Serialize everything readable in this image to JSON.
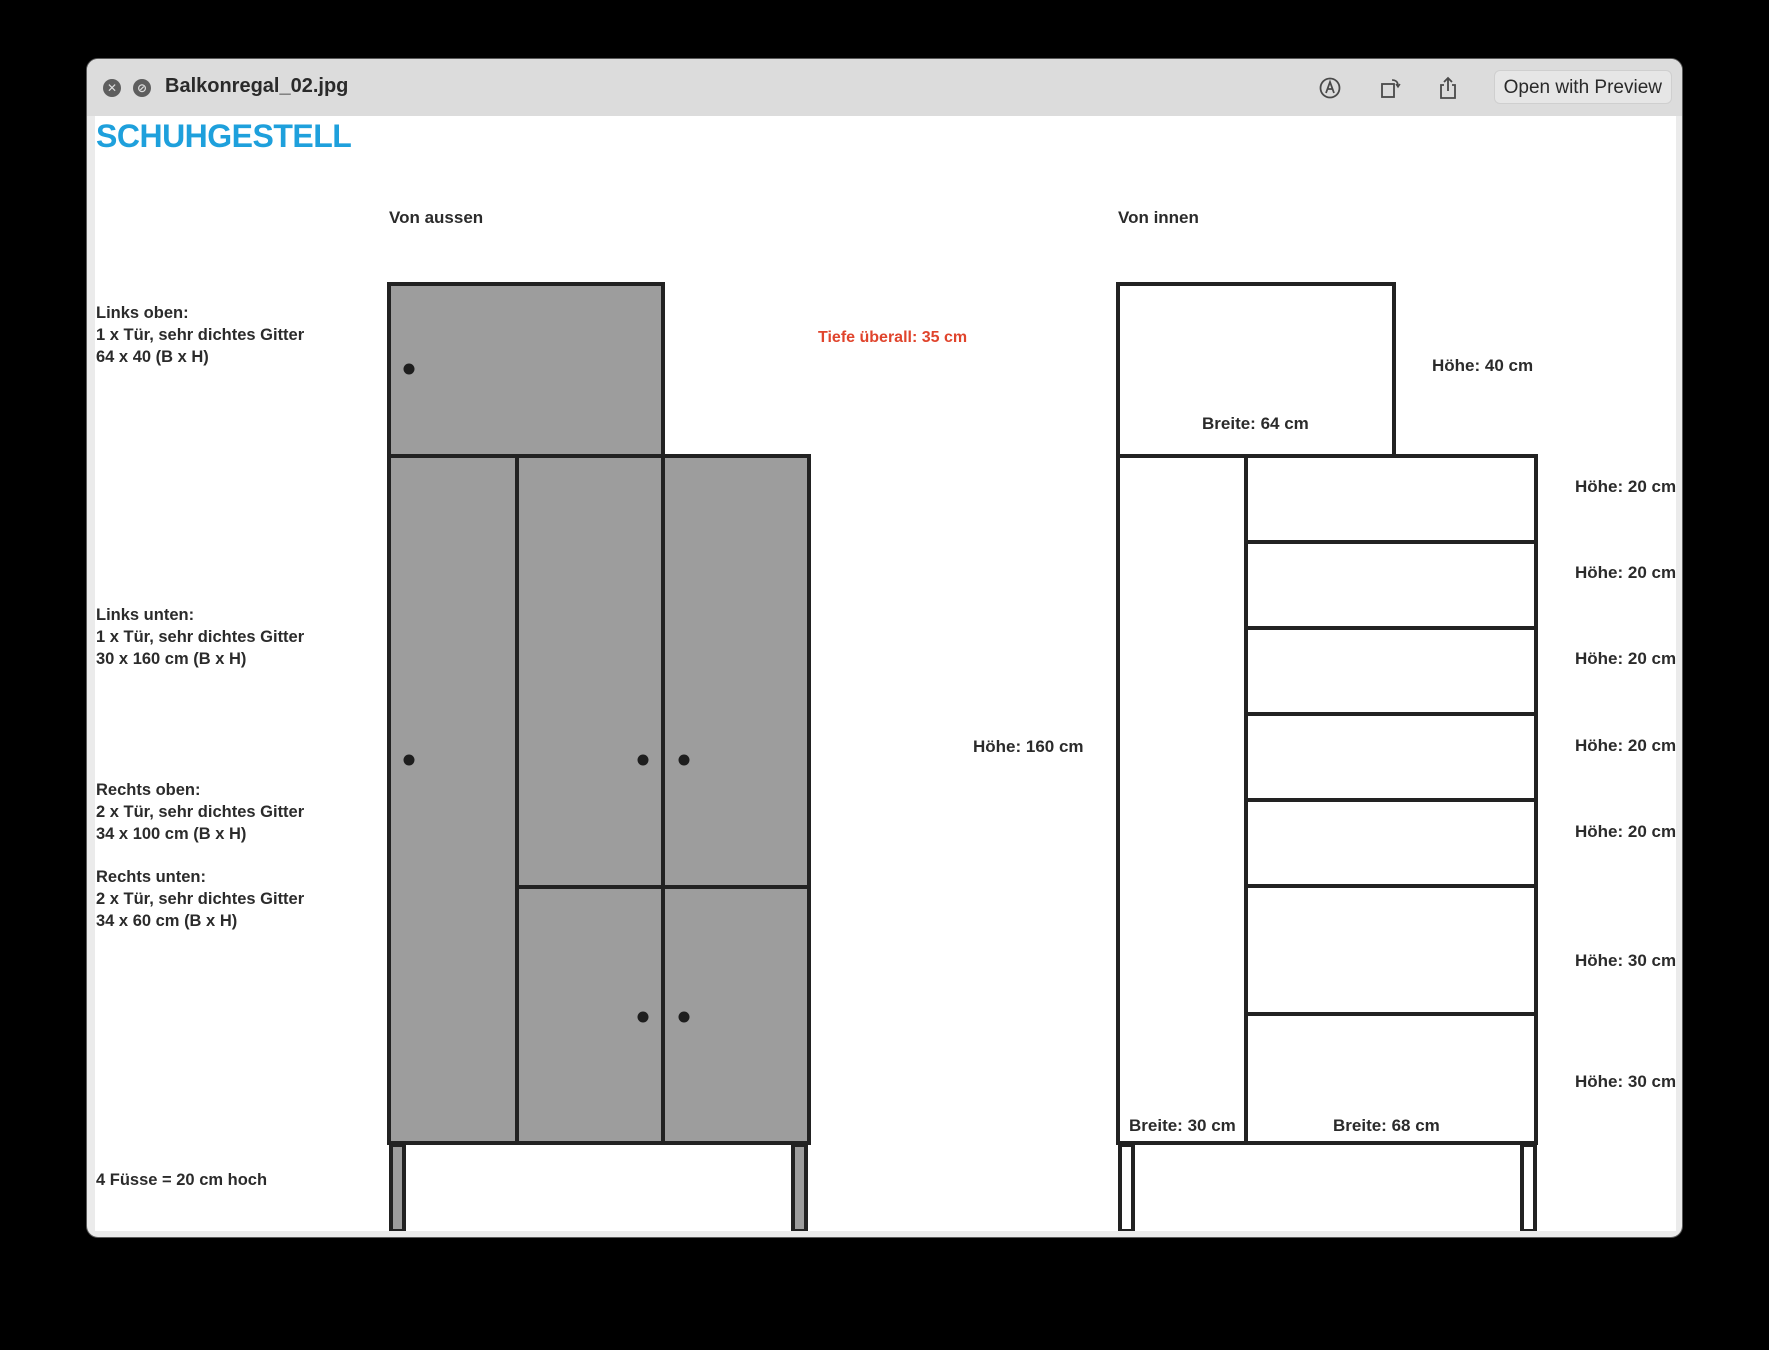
{
  "window": {
    "title": "Balkonregal_02.jpg",
    "open_button": "Open with Preview"
  },
  "colors": {
    "heading": "#1ea0dc",
    "door_fill": "#9d9d9d",
    "outline": "#222222",
    "note": "#e0442c"
  },
  "document": {
    "heading": "SCHUHGESTELL",
    "view_outside": "Von aussen",
    "view_inside": "Von innen",
    "depth_note": "Tiefe überall: 35 cm",
    "descriptions": [
      {
        "title": "Links oben:",
        "line1": "1 x Tür, sehr dichtes Gitter",
        "line2": "64 x 40 (B x H)"
      },
      {
        "title": "Links unten:",
        "line1": "1 x Tür, sehr dichtes Gitter",
        "line2": "30 x 160 cm (B x H)"
      },
      {
        "title": "Rechts oben:",
        "line1": "2 x Tür, sehr dichtes Gitter",
        "line2": "34 x 100 cm (B x H)"
      },
      {
        "title": "Rechts unten:",
        "line1": "2 x Tür, sehr dichtes Gitter",
        "line2": "34 x 60 cm (B x H)"
      }
    ],
    "feet_note": "4 Füsse = 20 cm hoch",
    "height_total": "Höhe: 160 cm",
    "inside": {
      "top_height": "Höhe: 40 cm",
      "top_width": "Breite: 64 cm",
      "left_width": "Breite: 30 cm",
      "right_width": "Breite: 68 cm",
      "shelf_heights": [
        "Höhe: 20 cm",
        "Höhe: 20 cm",
        "Höhe: 20 cm",
        "Höhe: 20 cm",
        "Höhe: 20 cm",
        "Höhe: 30 cm",
        "Höhe: 30 cm"
      ]
    }
  }
}
